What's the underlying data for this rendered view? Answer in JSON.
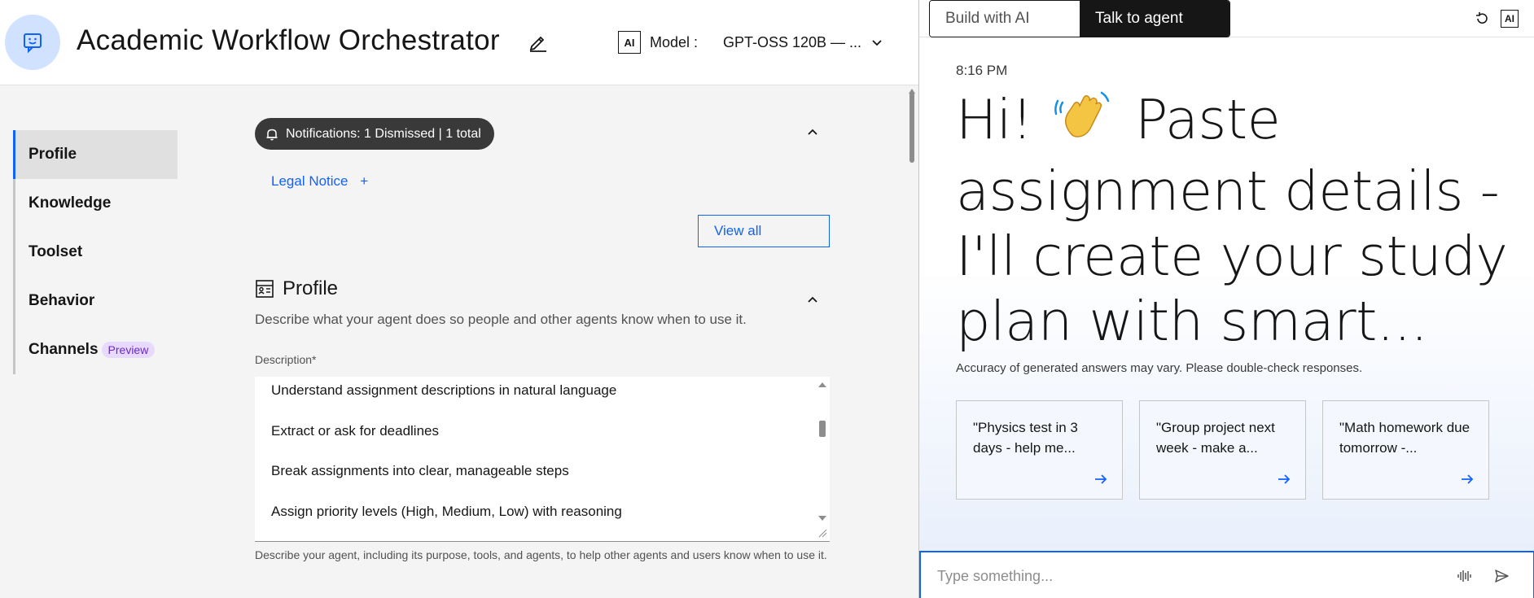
{
  "header": {
    "title": "Academic Workflow Orchestrator",
    "ai_badge": "AI",
    "model_label": "Model :",
    "model_value": "GPT-OSS 120B — ..."
  },
  "sidebar": {
    "items": [
      {
        "label": "Profile",
        "active": true
      },
      {
        "label": "Knowledge",
        "active": false
      },
      {
        "label": "Toolset",
        "active": false
      },
      {
        "label": "Behavior",
        "active": false
      },
      {
        "label": "Channels",
        "active": false,
        "tag": "Preview"
      }
    ]
  },
  "notifications": {
    "pill_text": "Notifications: 1 Dismissed | 1 total",
    "legal_notice": "Legal Notice",
    "view_all": "View all"
  },
  "profile": {
    "heading": "Profile",
    "subtitle": "Describe what your agent does so people and other agents know when to use it.",
    "description_label": "Description*",
    "description_lines": [
      "Understand assignment descriptions in natural language",
      "Extract or ask for deadlines",
      "Break assignments into clear, manageable steps",
      "Assign priority levels (High, Medium, Low) with reasoning"
    ],
    "helper_text": "Describe your agent, including its purpose, tools, and agents, to help other agents and users know when to use it."
  },
  "chat": {
    "tabs": [
      {
        "label": "Build with AI",
        "active": false
      },
      {
        "label": "Talk to agent",
        "active": true
      }
    ],
    "ai_badge": "AI",
    "timestamp": "8:16 PM",
    "greeting_before": "Hi!",
    "greeting_after": "Paste assignment details - I'll create your study plan with smart...",
    "disclaimer": "Accuracy of generated answers may vary. Please double-check responses.",
    "suggestions": [
      "\"Physics test in 3 days - help me...",
      "\"Group project next week - make a...",
      "\"Math homework due tomorrow -..."
    ],
    "input_placeholder": "Type something..."
  },
  "colors": {
    "accent": "#0f62fe",
    "pill_bg": "#393939",
    "avatar_bg": "#d0e2ff",
    "preview_tag_bg": "#e8daff",
    "preview_tag_text": "#6929c4"
  }
}
